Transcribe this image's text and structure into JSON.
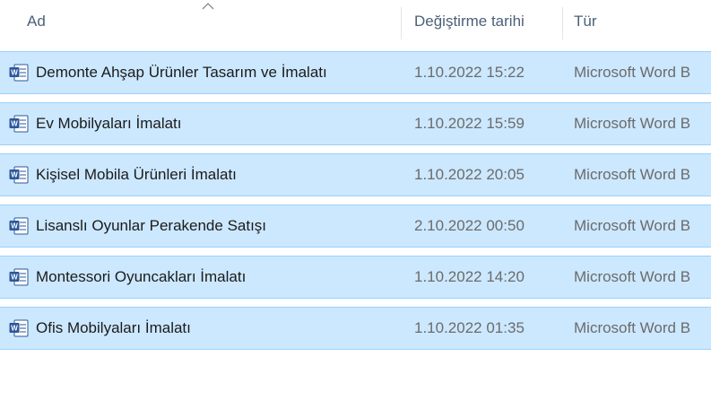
{
  "columns": {
    "name": "Ad",
    "date": "Değiştirme tarihi",
    "type": "Tür"
  },
  "rows": [
    {
      "name": "Demonte Ahşap Ürünler Tasarım ve İmalatı",
      "date": "1.10.2022 15:22",
      "type": "Microsoft Word B",
      "icon": "word-document-icon"
    },
    {
      "name": "Ev Mobilyaları İmalatı",
      "date": "1.10.2022 15:59",
      "type": "Microsoft Word B",
      "icon": "word-document-icon"
    },
    {
      "name": "Kişisel Mobila Ürünleri İmalatı",
      "date": "1.10.2022 20:05",
      "type": "Microsoft Word B",
      "icon": "word-document-icon"
    },
    {
      "name": "Lisanslı Oyunlar Perakende Satışı",
      "date": "2.10.2022 00:50",
      "type": "Microsoft Word B",
      "icon": "word-document-icon"
    },
    {
      "name": "Montessori Oyuncakları İmalatı",
      "date": "1.10.2022 14:20",
      "type": "Microsoft Word B",
      "icon": "word-document-icon"
    },
    {
      "name": "Ofis Mobilyaları İmalatı",
      "date": "1.10.2022 01:35",
      "type": "Microsoft Word B",
      "icon": "word-document-icon"
    }
  ],
  "colors": {
    "selected_row_bg": "#cce8ff",
    "selected_row_border": "#99d1ff",
    "word_blue": "#2b579a"
  }
}
